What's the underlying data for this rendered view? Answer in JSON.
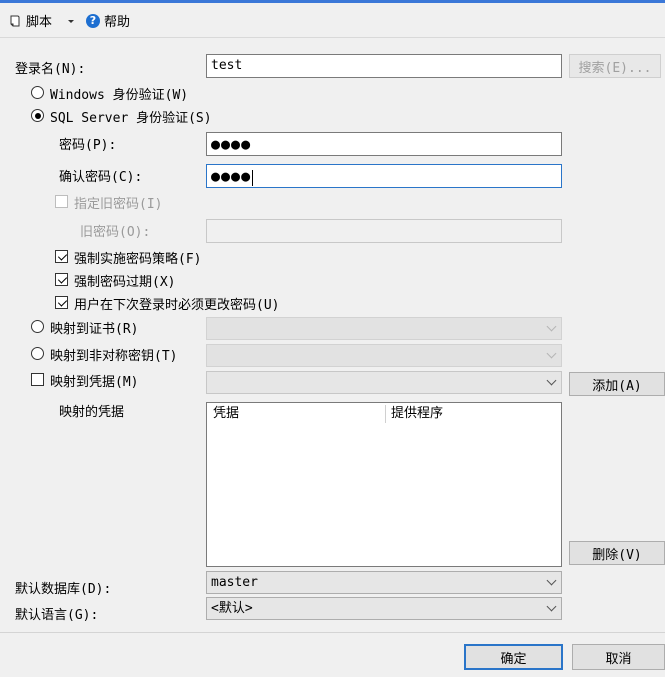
{
  "toolbar": {
    "script_label": "脚本",
    "help_label": "帮助"
  },
  "login": {
    "label": "登录名(N):",
    "value": "test",
    "search_button": "搜索(E)..."
  },
  "auth": {
    "windows_label": "Windows 身份验证(W)",
    "sql_label": "SQL Server 身份验证(S)"
  },
  "password": {
    "label": "密码(P):",
    "masked": "●●●●"
  },
  "confirm": {
    "label": "确认密码(C):",
    "masked": "●●●●"
  },
  "old_password": {
    "specify_label": "指定旧密码(I)",
    "label": "旧密码(O):",
    "value": ""
  },
  "policies": {
    "enforce_policy": "强制实施密码策略(F)",
    "enforce_expiration": "强制密码过期(X)",
    "must_change": "用户在下次登录时必须更改密码(U)"
  },
  "mapping": {
    "certificate_label": "映射到证书(R)",
    "asymmetric_label": "映射到非对称密钥(T)",
    "credential_label": "映射到凭据(M)",
    "add_button": "添加(A)",
    "mapped_credentials_label": "映射的凭据",
    "columns": [
      "凭据",
      "提供程序"
    ],
    "remove_button": "删除(V)"
  },
  "defaults": {
    "database_label": "默认数据库(D):",
    "database_value": "master",
    "language_label": "默认语言(G):",
    "language_value": "<默认>"
  },
  "footer": {
    "ok_button": "确定",
    "cancel_button": "取消"
  },
  "colors": {
    "accent": "#2a75c9",
    "help_icon": "#1d6fd1"
  }
}
